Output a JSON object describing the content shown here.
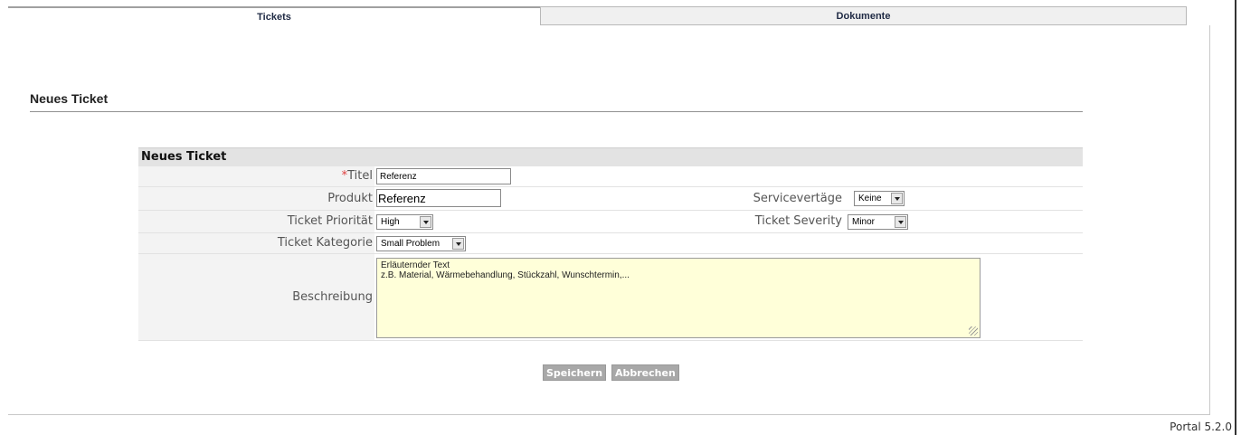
{
  "tabs": [
    {
      "label": "Tickets",
      "active": true
    },
    {
      "label": "Dokumente",
      "active": false
    }
  ],
  "page": {
    "title": "Neues Ticket"
  },
  "form": {
    "section_title": "Neues Ticket",
    "required_marker": "*",
    "fields": {
      "titel": {
        "label": "Titel",
        "value": "Referenz"
      },
      "produkt": {
        "label": "Produkt",
        "value": "Referenz"
      },
      "servicevertraege": {
        "label": "Servicevertäge",
        "selected": "Keine"
      },
      "prioritaet": {
        "label": "Ticket Priorität",
        "selected": "High"
      },
      "severity": {
        "label": "Ticket Severity",
        "selected": "Minor"
      },
      "kategorie": {
        "label": "Ticket Kategorie",
        "selected": "Small Problem"
      },
      "beschreibung": {
        "label": "Beschreibung",
        "line1": "Erläuternder Text",
        "line2": "z.B. Material, Wärmebehandlung, Stückzahl, Wunschtermin,..."
      }
    },
    "buttons": {
      "save": "Speichern",
      "cancel": "Abbrechen"
    }
  },
  "footer": {
    "version": "Portal 5.2.0"
  },
  "colors": {
    "description_bg": "#ffffd9",
    "button_bg": "#a8a8a8",
    "required": "#e04040"
  }
}
